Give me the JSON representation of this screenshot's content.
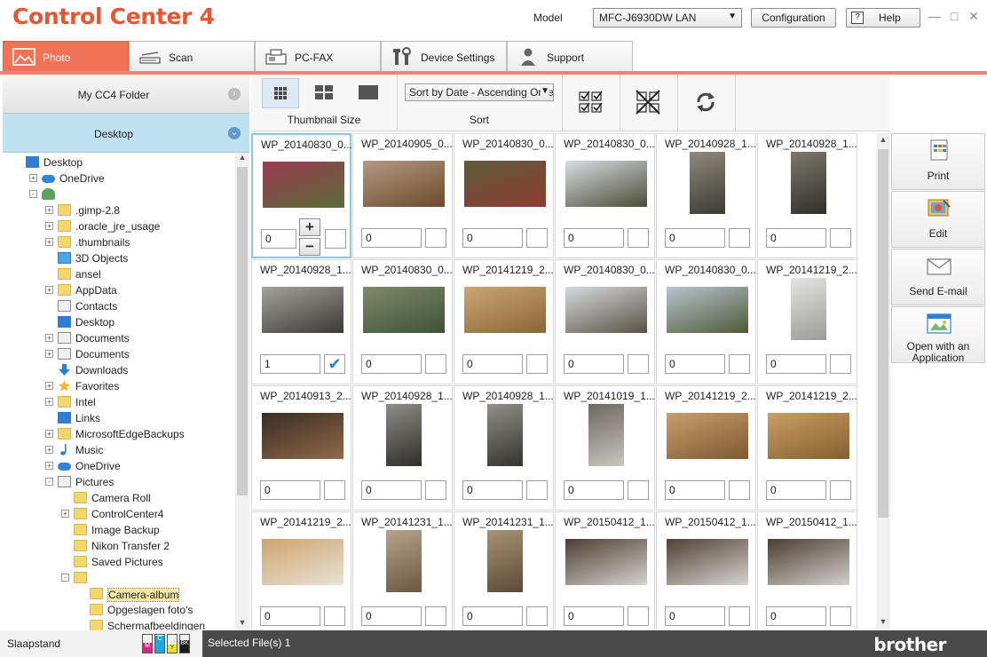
{
  "app": {
    "title": "ControlCenter4",
    "brand": "brother"
  },
  "header": {
    "model_label": "Model",
    "model_value": "MFC-J6930DW LAN",
    "configuration_label": "Configuration",
    "help_label": "Help"
  },
  "tabs": [
    {
      "label": "Photo",
      "icon": "photo-icon",
      "active": true
    },
    {
      "label": "Scan",
      "icon": "scanner-icon",
      "active": false
    },
    {
      "label": "PC-FAX",
      "icon": "fax-icon",
      "active": false
    },
    {
      "label": "Device Settings",
      "icon": "tools-icon",
      "active": false
    },
    {
      "label": "Support",
      "icon": "person-icon",
      "active": false
    }
  ],
  "left": {
    "cc4_folder": "My CC4 Folder",
    "desktop": "Desktop",
    "tree": [
      {
        "label": "Desktop",
        "icon": "desktop-icon"
      },
      {
        "label": "OneDrive",
        "icon": "cloud-icon"
      },
      {
        "label": "",
        "icon": "user-icon"
      },
      {
        "label": ".gimp-2.8",
        "icon": "folder-icon"
      },
      {
        "label": ".oracle_jre_usage",
        "icon": "folder-icon"
      },
      {
        "label": ".thumbnails",
        "icon": "folder-icon"
      },
      {
        "label": "3D Objects",
        "icon": "cube-icon"
      },
      {
        "label": "ansel",
        "icon": "folder-icon"
      },
      {
        "label": "AppData",
        "icon": "folder-icon"
      },
      {
        "label": "Contacts",
        "icon": "contacts-icon"
      },
      {
        "label": "Desktop",
        "icon": "desktop-icon"
      },
      {
        "label": "Documents",
        "icon": "documents-icon"
      },
      {
        "label": "Documents",
        "icon": "documents-icon"
      },
      {
        "label": "Downloads",
        "icon": "download-icon"
      },
      {
        "label": "Favorites",
        "icon": "star-icon"
      },
      {
        "label": "Intel",
        "icon": "folder-icon"
      },
      {
        "label": "Links",
        "icon": "link-icon"
      },
      {
        "label": "MicrosoftEdgeBackups",
        "icon": "folder-icon"
      },
      {
        "label": "Music",
        "icon": "music-icon"
      },
      {
        "label": "OneDrive",
        "icon": "cloud-icon"
      },
      {
        "label": "Pictures",
        "icon": "pictures-icon"
      },
      {
        "label": "Camera Roll",
        "icon": "folder-icon"
      },
      {
        "label": "ControlCenter4",
        "icon": "folder-icon"
      },
      {
        "label": "Image Backup",
        "icon": "folder-icon"
      },
      {
        "label": "Nikon Transfer 2",
        "icon": "folder-icon"
      },
      {
        "label": "Saved Pictures",
        "icon": "folder-icon"
      },
      {
        "label": "",
        "icon": "folder-icon"
      },
      {
        "label": "Camera-album",
        "icon": "folder-icon"
      },
      {
        "label": "Opgeslagen foto's",
        "icon": "folder-icon"
      },
      {
        "label": "Schermafbeeldingen",
        "icon": "folder-icon"
      }
    ]
  },
  "toolbar": {
    "thumbnail_size_label": "Thumbnail Size",
    "sort_label": "Sort",
    "sort_value": "Sort by Date - Ascending Orde"
  },
  "photos": [
    {
      "name": "WP_20140830_0...",
      "qty": "0",
      "checked": false,
      "colors": [
        "#9a3b52",
        "#5b6b3a"
      ],
      "portrait": false
    },
    {
      "name": "WP_20140905_0...",
      "qty": "0",
      "checked": false,
      "colors": [
        "#b39a86",
        "#6b4a2a"
      ],
      "portrait": false
    },
    {
      "name": "WP_20140830_0...",
      "qty": "0",
      "checked": false,
      "colors": [
        "#5e5a3a",
        "#8e3b33"
      ],
      "portrait": false
    },
    {
      "name": "WP_20140830_0...",
      "qty": "0",
      "checked": false,
      "colors": [
        "#d9dde3",
        "#4b4c37"
      ],
      "portrait": false
    },
    {
      "name": "WP_20140928_1...",
      "qty": "0",
      "checked": false,
      "colors": [
        "#8f8a7c",
        "#3c3a34"
      ],
      "portrait": true
    },
    {
      "name": "WP_20140928_1...",
      "qty": "0",
      "checked": false,
      "colors": [
        "#7d786c",
        "#2f2f2a"
      ],
      "portrait": true
    },
    {
      "name": "WP_20140928_1...",
      "qty": "1",
      "checked": true,
      "colors": [
        "#a4a29a",
        "#3a3935"
      ],
      "portrait": false
    },
    {
      "name": "WP_20140830_0...",
      "qty": "0",
      "checked": false,
      "colors": [
        "#7f8a6c",
        "#3f5234"
      ],
      "portrait": false
    },
    {
      "name": "WP_20141219_2...",
      "qty": "0",
      "checked": false,
      "colors": [
        "#c9a777",
        "#8a6438"
      ],
      "portrait": false
    },
    {
      "name": "WP_20140830_0...",
      "qty": "0",
      "checked": false,
      "colors": [
        "#d6d9de",
        "#5a5344"
      ],
      "portrait": false
    },
    {
      "name": "WP_20140830_0...",
      "qty": "0",
      "checked": false,
      "colors": [
        "#b8c3ce",
        "#4f5a38"
      ],
      "portrait": false
    },
    {
      "name": "WP_20141219_2...",
      "qty": "0",
      "checked": false,
      "colors": [
        "#e3e3e0",
        "#9c9c98"
      ],
      "portrait": true
    },
    {
      "name": "WP_20140913_2...",
      "qty": "0",
      "checked": false,
      "colors": [
        "#3a2c22",
        "#8f6a4a"
      ],
      "portrait": false
    },
    {
      "name": "WP_20140928_1...",
      "qty": "0",
      "checked": false,
      "colors": [
        "#8e8c86",
        "#2f2e2a"
      ],
      "portrait": true
    },
    {
      "name": "WP_20140928_1...",
      "qty": "0",
      "checked": false,
      "colors": [
        "#918f88",
        "#34332e"
      ],
      "portrait": true
    },
    {
      "name": "WP_20141019_1...",
      "qty": "0",
      "checked": false,
      "colors": [
        "#6d6860",
        "#c9c6bd"
      ],
      "portrait": true
    },
    {
      "name": "WP_20141219_2...",
      "qty": "0",
      "checked": false,
      "colors": [
        "#c89e6c",
        "#7d5a32"
      ],
      "portrait": false
    },
    {
      "name": "WP_20141219_2...",
      "qty": "0",
      "checked": false,
      "colors": [
        "#c99d66",
        "#84602f"
      ],
      "portrait": false
    },
    {
      "name": "WP_20141219_2...",
      "qty": "0",
      "checked": false,
      "colors": [
        "#cfa46e",
        "#e8e2d6"
      ],
      "portrait": false
    },
    {
      "name": "WP_20141231_1...",
      "qty": "0",
      "checked": false,
      "colors": [
        "#b5a38a",
        "#6a5842"
      ],
      "portrait": true
    },
    {
      "name": "WP_20141231_1...",
      "qty": "0",
      "checked": false,
      "colors": [
        "#a89274",
        "#5a4a38"
      ],
      "portrait": true
    },
    {
      "name": "WP_20150412_1...",
      "qty": "0",
      "checked": false,
      "colors": [
        "#4d3e33",
        "#d4d2cc"
      ],
      "portrait": false
    },
    {
      "name": "WP_20150412_1...",
      "qty": "0",
      "checked": false,
      "colors": [
        "#4f4034",
        "#d6d4cf"
      ],
      "portrait": false
    },
    {
      "name": "WP_20150412_1...",
      "qty": "0",
      "checked": false,
      "colors": [
        "#4b3d32",
        "#d2d0ca"
      ],
      "portrait": false
    }
  ],
  "actions": [
    {
      "label": "Print",
      "icon": "print-icon"
    },
    {
      "label": "Edit",
      "icon": "edit-icon"
    },
    {
      "label": "Send E-mail",
      "icon": "email-icon"
    },
    {
      "label": "Open with an Application",
      "icon": "open-app-icon"
    }
  ],
  "status": {
    "device_state": "Slaapstand",
    "selected_files": "Selected File(s) 1",
    "ink": [
      {
        "label": "M",
        "color": "#d6268a",
        "level": 0.55
      },
      {
        "label": "C",
        "color": "#18a9e1",
        "level": 0.95
      },
      {
        "label": "Y",
        "color": "#f0e01a",
        "level": 0.45
      },
      {
        "label": "BK",
        "color": "#1a1a1a",
        "level": 0.7
      }
    ]
  },
  "colors": {
    "accent": "#f07257",
    "selected_folder": "#bfe1f2",
    "status_bar": "#4a4a4a"
  }
}
